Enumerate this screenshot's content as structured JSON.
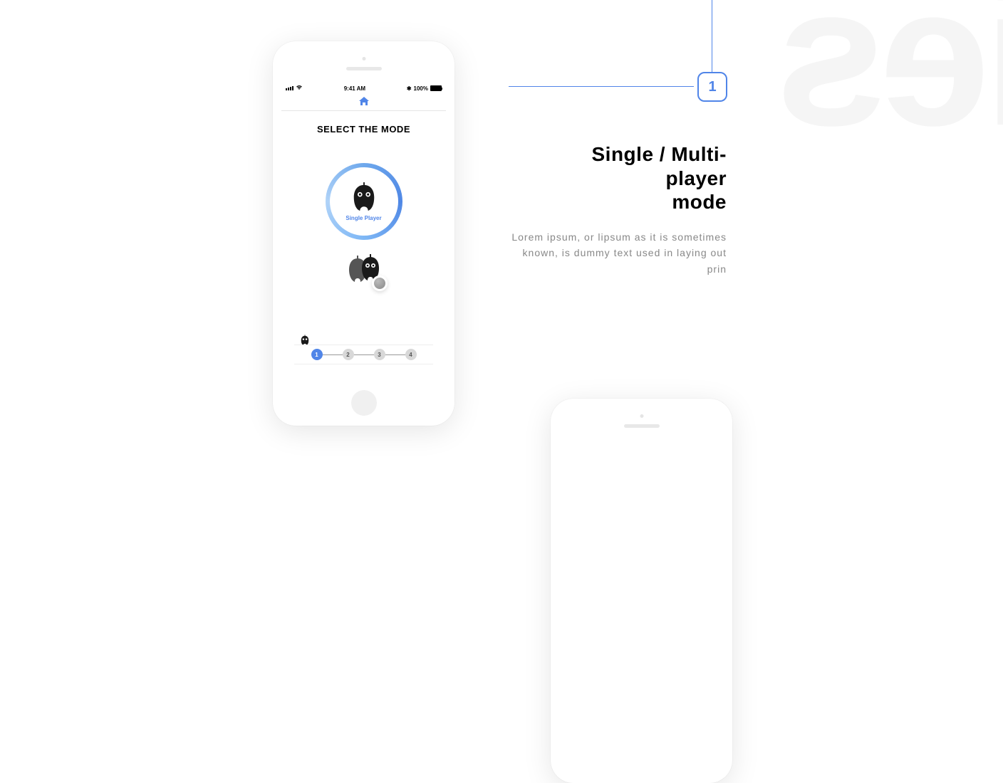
{
  "step_badge": "1",
  "title_line1": "Single / Multi-",
  "title_line2": "player",
  "title_line3": "mode",
  "description": "Lorem ipsum, or lipsum as it is sometimes known, is dummy text used in laying out prin",
  "phone": {
    "status": {
      "time": "9:41 AM",
      "battery_pct": "100%",
      "bluetooth": "✻"
    },
    "mode_title": "SELECT THE MODE",
    "single_player_label": "Single Player",
    "steps": [
      "1",
      "2",
      "3",
      "4"
    ],
    "active_step": 0
  },
  "bg_text": "ies"
}
